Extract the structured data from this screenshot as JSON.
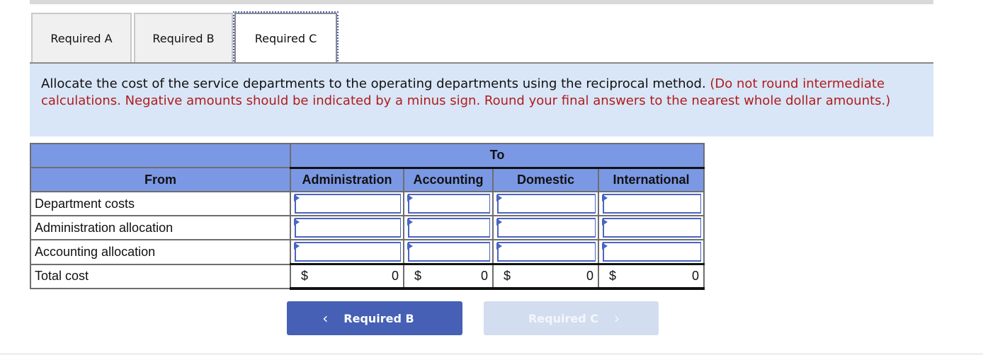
{
  "tabs": [
    {
      "label": "Required A",
      "active": false
    },
    {
      "label": "Required B",
      "active": false
    },
    {
      "label": "Required C",
      "active": true
    }
  ],
  "instructions": {
    "main": "Allocate the cost of the service departments to the operating departments using the reciprocal method.",
    "note": "(Do not round intermediate calculations. Negative amounts should be indicated by a minus sign. Round your final answers to the nearest whole dollar amounts.)"
  },
  "table": {
    "group_header": "To",
    "from_header": "From",
    "columns": [
      "Administration",
      "Accounting",
      "Domestic",
      "International"
    ],
    "rows": [
      {
        "label": "Department costs",
        "values": [
          "",
          "",
          "",
          ""
        ]
      },
      {
        "label": "Administration allocation",
        "values": [
          "",
          "",
          "",
          ""
        ]
      },
      {
        "label": "Accounting allocation",
        "values": [
          "",
          "",
          "",
          ""
        ]
      }
    ],
    "total": {
      "label": "Total cost",
      "currency": "$",
      "values": [
        "0",
        "0",
        "0",
        "0"
      ]
    }
  },
  "nav": {
    "prev_label": "Required B",
    "next_label": "Required C",
    "prev_icon": "chevron-left-icon",
    "next_icon": "chevron-right-icon"
  }
}
